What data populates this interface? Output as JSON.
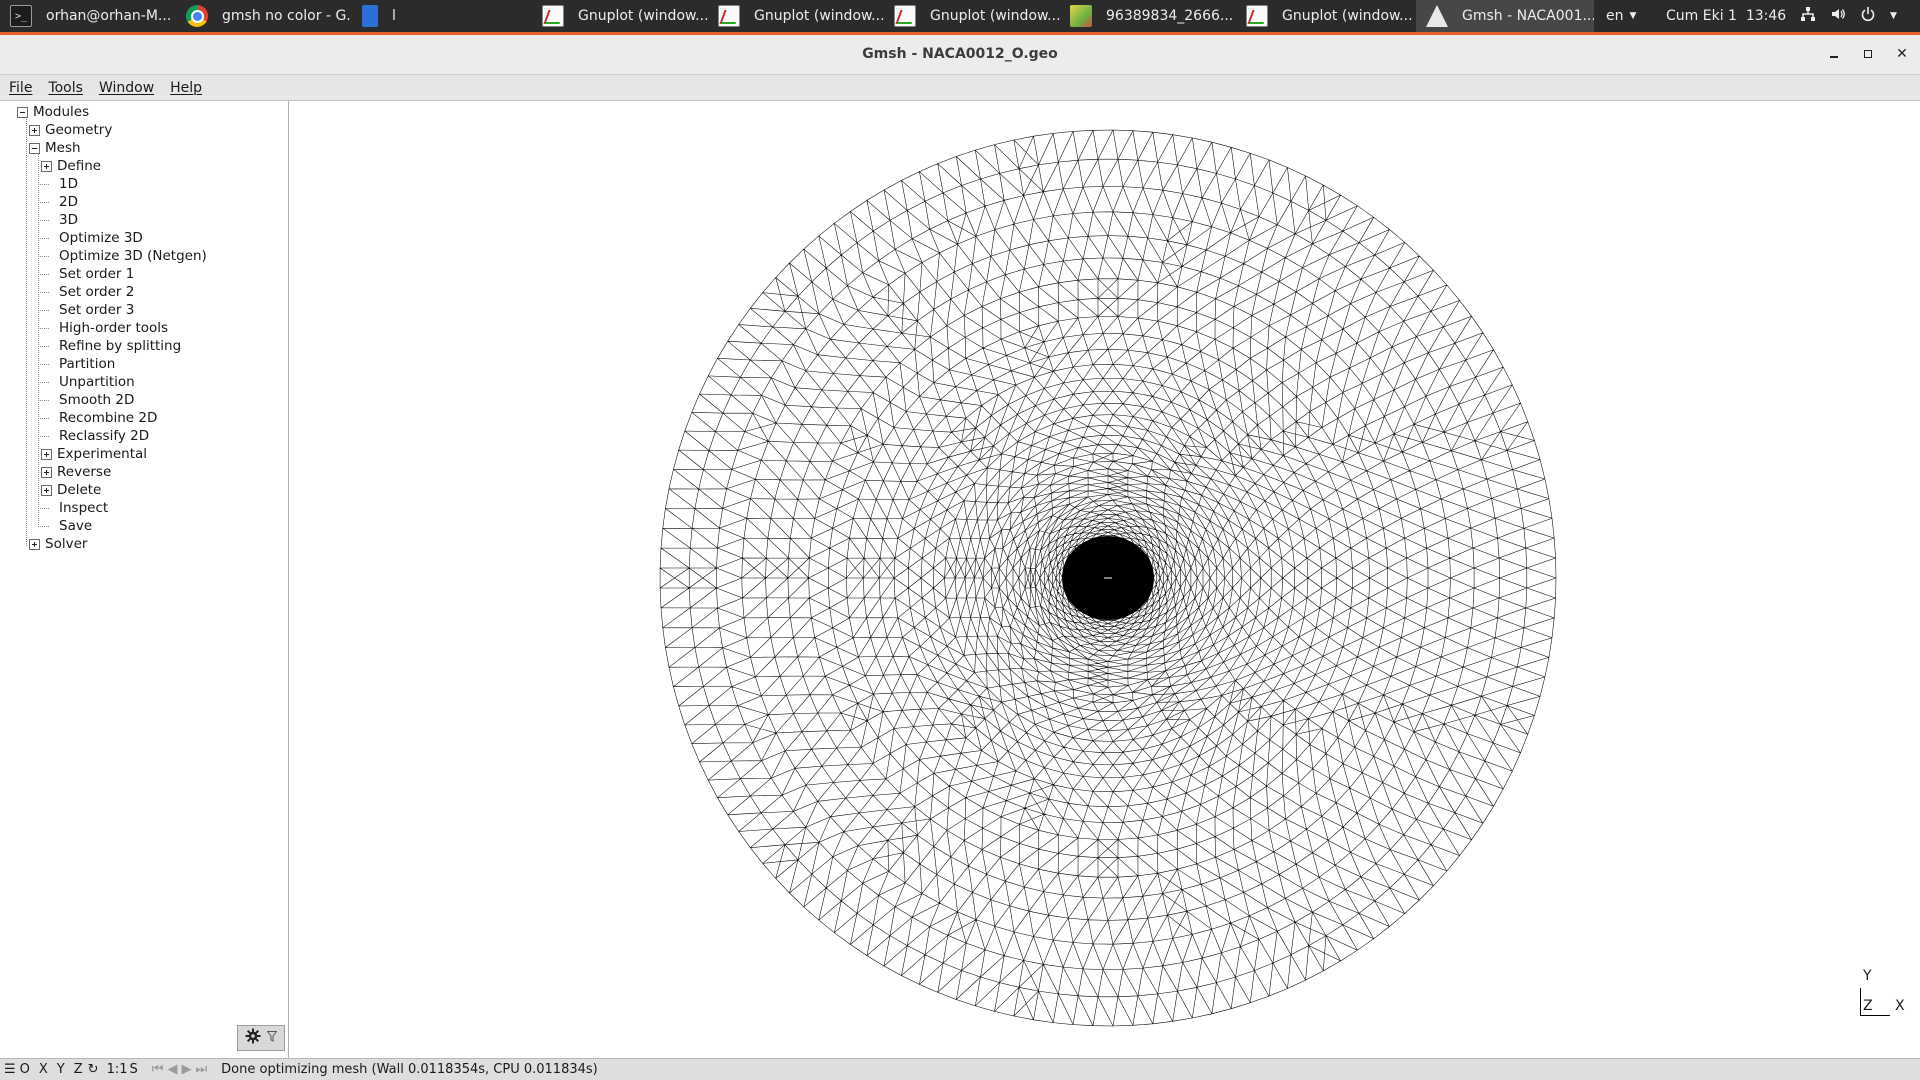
{
  "taskbar": {
    "tasks": [
      {
        "label": "orhan@orhan-M...",
        "icon": "terminal-icon"
      },
      {
        "label": "gmsh no color - G...",
        "icon": "chrome-icon"
      },
      {
        "label": "l",
        "icon": "document-icon"
      },
      {
        "label": "Gnuplot (window...",
        "icon": "gnuplot-icon"
      },
      {
        "label": "Gnuplot (window...",
        "icon": "gnuplot-icon"
      },
      {
        "label": "Gnuplot (window...",
        "icon": "gnuplot-icon"
      },
      {
        "label": "96389834_2666...",
        "icon": "image-viewer-icon"
      },
      {
        "label": "Gnuplot (window...",
        "icon": "gnuplot-icon"
      },
      {
        "label": "Gmsh - NACA001...",
        "icon": "gmsh-icon"
      }
    ],
    "language": "en",
    "datetime": "Cum Eki 1  13:46"
  },
  "window": {
    "title": "Gmsh - NACA0012_O.geo"
  },
  "menu": {
    "items": [
      "File",
      "Tools",
      "Window",
      "Help"
    ]
  },
  "tree": {
    "root": "Modules",
    "geometry": "Geometry",
    "mesh": "Mesh",
    "mesh_items": [
      "Define",
      "1D",
      "2D",
      "3D",
      "Optimize 3D",
      "Optimize 3D (Netgen)",
      "Set order 1",
      "Set order 2",
      "Set order 3",
      "High-order tools",
      "Refine by splitting",
      "Partition",
      "Unpartition",
      "Smooth 2D",
      "Recombine 2D",
      "Reclassify 2D",
      "Experimental",
      "Reverse",
      "Delete",
      "Inspect",
      "Save"
    ],
    "solver": "Solver"
  },
  "axes": {
    "y": "Y",
    "z": "Z",
    "x": "X"
  },
  "statusbar": {
    "buttons": [
      "O",
      "X",
      "Y",
      "Z",
      "1:1",
      "S"
    ],
    "message": "Done optimizing mesh (Wall 0.0118354s, CPU 0.011834s)"
  }
}
